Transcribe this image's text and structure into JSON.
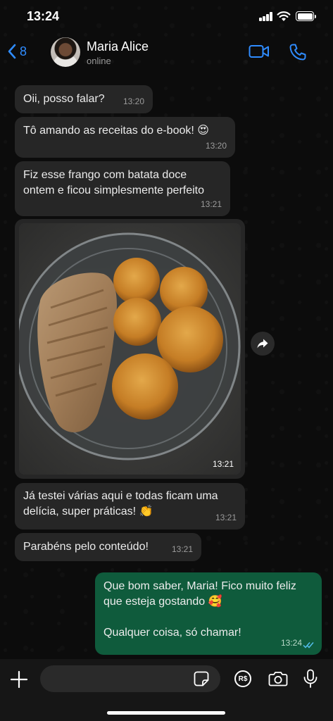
{
  "status_bar": {
    "time": "13:24"
  },
  "header": {
    "back_count": "8",
    "contact_name": "Maria Alice",
    "contact_status": "online"
  },
  "messages": [
    {
      "direction": "in",
      "text": "Oii, posso falar?",
      "time": "13:20"
    },
    {
      "direction": "in",
      "text": "Tô amando as receitas do e-book! 😍",
      "time": "13:20"
    },
    {
      "direction": "in",
      "lines": [
        "Fiz esse frango com batata doce",
        "ontem e ficou simplesmente perfeito"
      ],
      "time": "13:21"
    },
    {
      "direction": "in",
      "type": "photo",
      "time": "13:21"
    },
    {
      "direction": "in",
      "lines": [
        "Já testei várias aqui e todas ficam uma",
        "delícia, super práticas! 👏"
      ],
      "time": "13:21"
    },
    {
      "direction": "in",
      "text": "Parabéns pelo conteúdo!",
      "time": "13:21"
    },
    {
      "direction": "out",
      "lines": [
        "Que bom saber, Maria! Fico muito feliz",
        "que esteja gostando 🥰",
        "",
        "Qualquer coisa, só chamar!"
      ],
      "time": "13:24",
      "read": true
    }
  ],
  "input_bar": {
    "pay_label": "R$"
  },
  "colors": {
    "accent": "#2f8cff",
    "incoming_bubble": "#262626",
    "outgoing_bubble": "#0f5b3c",
    "read_ticks": "#53bdeb"
  }
}
